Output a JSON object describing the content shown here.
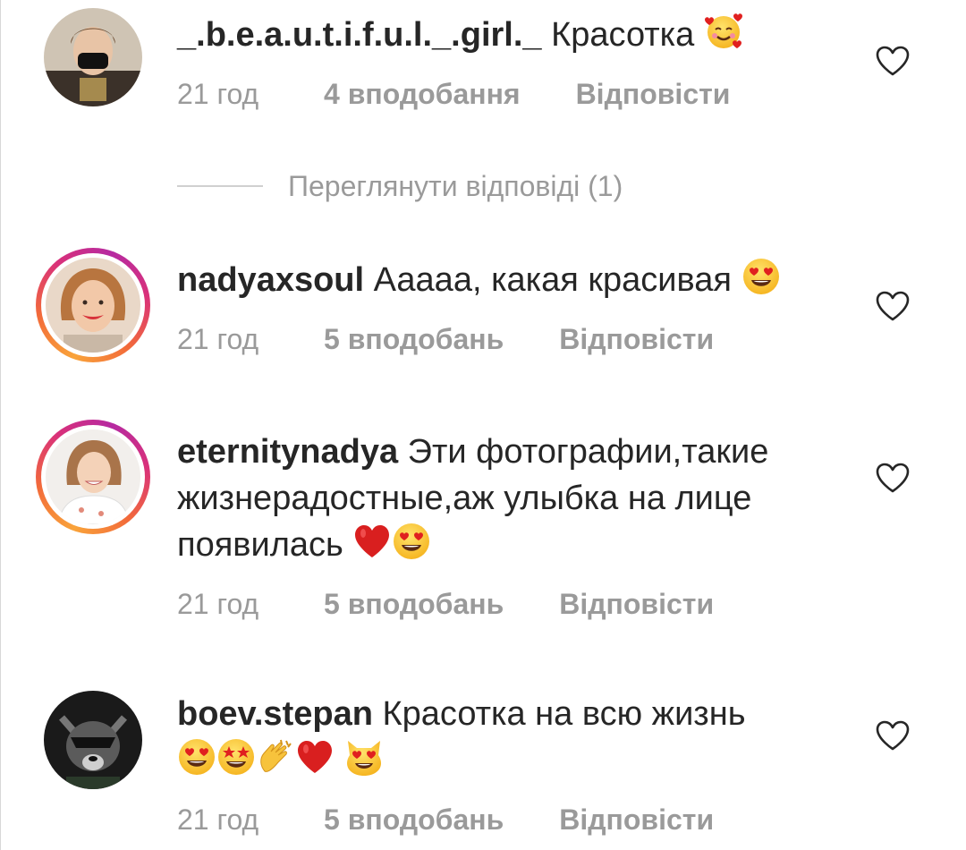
{
  "comments": [
    {
      "username": "_.b.e.a.u.t.i.f.u.l._.girl._",
      "text": "Красотка",
      "emojis": [
        "smiling-face-with-hearts"
      ],
      "time": "21 год",
      "likes": "4 вподобання",
      "reply": "Відповісти",
      "has_story": false
    },
    {
      "username": "nadyaxsoul",
      "text": "Ааааа, какая красивая",
      "emojis": [
        "heart-eyes"
      ],
      "time": "21 год",
      "likes": "5 вподобань",
      "reply": "Відповісти",
      "has_story": true
    },
    {
      "username": "eternitynadya",
      "text_line1": "Эти фотографии,такие",
      "text_line2": "жизнерадостные,аж улыбка на лице",
      "text_line3": "появилась",
      "emojis": [
        "red-heart",
        "heart-eyes"
      ],
      "time": "21 год",
      "likes": "5 вподобань",
      "reply": "Відповісти",
      "has_story": true
    },
    {
      "username": "boev.stepan",
      "text": "Красотка на всю жизнь",
      "emojis": [
        "heart-eyes",
        "star-struck",
        "clapping-hands",
        "red-heart",
        "heart-eyes-cat"
      ],
      "time": "21 год",
      "likes": "5 вподобань",
      "reply": "Відповісти",
      "has_story": false
    }
  ],
  "view_replies": "Переглянути відповіді (1)",
  "colors": {
    "text": "#262626",
    "meta": "#9a9a9a",
    "emoji_yellow": "#fbc02d",
    "emoji_red": "#e0201f"
  }
}
